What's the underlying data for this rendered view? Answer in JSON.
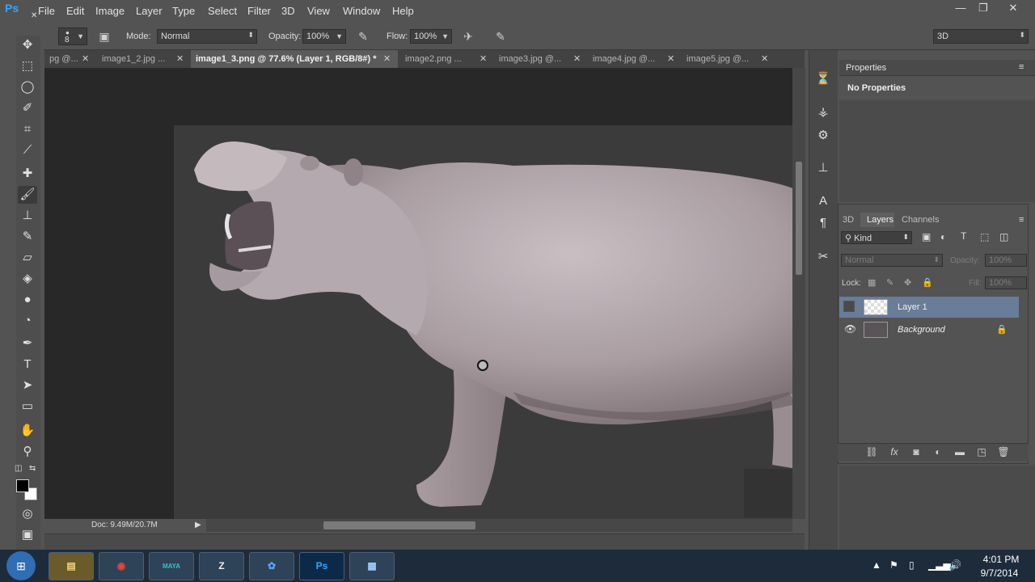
{
  "app": {
    "logo": "Ps",
    "logo_close": "✕"
  },
  "menu": {
    "items": [
      "File",
      "Edit",
      "Image",
      "Layer",
      "Type",
      "Select",
      "Filter",
      "3D",
      "View",
      "Window",
      "Help"
    ]
  },
  "window_controls": {
    "minimize": "—",
    "restore": "❐",
    "close": "✕"
  },
  "options": {
    "brush_size": "8",
    "mode_label": "Mode:",
    "mode_value": "Normal",
    "opacity_label": "Opacity:",
    "opacity_value": "100%",
    "flow_label": "Flow:",
    "flow_value": "100%",
    "workspace": "3D"
  },
  "tabs": [
    {
      "label": "pg @...",
      "active": false
    },
    {
      "label": "image1_2.jpg ...",
      "active": false
    },
    {
      "label": "image1_3.png @ 77.6% (Layer 1, RGB/8#) *",
      "active": true
    },
    {
      "label": "image2.png ...",
      "active": false
    },
    {
      "label": "image3.jpg @...",
      "active": false
    },
    {
      "label": "image4.jpg @...",
      "active": false
    },
    {
      "label": "image5.jpg @...",
      "active": false
    }
  ],
  "tab_close": "✕",
  "status": {
    "doc_size": "Doc: 9.49M/20.7M"
  },
  "properties": {
    "title": "Properties",
    "empty_text": "No Properties"
  },
  "layers_panel": {
    "tabs": [
      "3D",
      "Layers",
      "Channels"
    ],
    "filter_kind": "Kind",
    "blend_mode": "Normal",
    "opacity_label": "Opacity:",
    "opacity_value": "100%",
    "lock_label": "Lock:",
    "fill_label": "Fill:",
    "fill_value": "100%",
    "layers": [
      {
        "name": "Layer 1",
        "visible": false,
        "selected": true
      },
      {
        "name": "Background",
        "visible": true,
        "selected": false,
        "locked": true
      }
    ]
  },
  "taskbar": {
    "apps": [
      "explorer",
      "chrome",
      "maya",
      "zbrush",
      "flower",
      "photoshop",
      "control-panel"
    ],
    "maya_label": "MAYA",
    "ps_label": "Ps"
  },
  "clock": {
    "time": "4:01 PM",
    "date": "9/7/2014"
  },
  "colors": {
    "foreground": "#000000",
    "background": "#ffffff",
    "accent": "#31a8ff",
    "selected_layer": "#697c98"
  }
}
